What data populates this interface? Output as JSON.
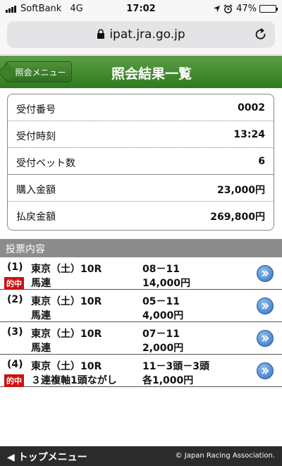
{
  "status_bar": {
    "carrier": "SoftBank",
    "network": "4G",
    "time": "17:02",
    "battery": "47%",
    "battery_level": 0.47
  },
  "browser": {
    "url": "ipat.jra.go.jp",
    "icons": [
      "lock-icon",
      "reload-icon"
    ]
  },
  "header": {
    "back_label": "照会メニュー",
    "title": "照会結果一覧"
  },
  "summary": [
    {
      "label": "受付番号",
      "value": "0002"
    },
    {
      "label": "受付時刻",
      "value": "13:24"
    },
    {
      "label": "受付ベット数",
      "value": "6"
    },
    {
      "label": "購入金額",
      "value": "23,000円"
    },
    {
      "label": "払戻金額",
      "value": "269,800円"
    }
  ],
  "section_title": "投票内容",
  "bets": [
    {
      "num": "(1)",
      "place": "東京（土）10R",
      "type": "馬連",
      "combo": "08－11",
      "amount": "14,000円",
      "hit": "的中"
    },
    {
      "num": "(2)",
      "place": "東京（土）10R",
      "type": "馬連",
      "combo": "05－11",
      "amount": "4,000円",
      "hit": ""
    },
    {
      "num": "(3)",
      "place": "東京（土）10R",
      "type": "馬連",
      "combo": "07－11",
      "amount": "2,000円",
      "hit": ""
    },
    {
      "num": "(4)",
      "place": "東京（土）10R",
      "type": "３連複軸1頭ながし",
      "combo": "11－3頭－3頭",
      "amount": "各1,000円",
      "hit": "的中"
    }
  ],
  "footer": {
    "top_menu": "◀ トップメニュー",
    "copyright": "© Japan Racing Association."
  },
  "colors": {
    "header_green": "#2f7a1f",
    "hit_red": "#cc1111",
    "go_blue": "#2f6ec2"
  }
}
